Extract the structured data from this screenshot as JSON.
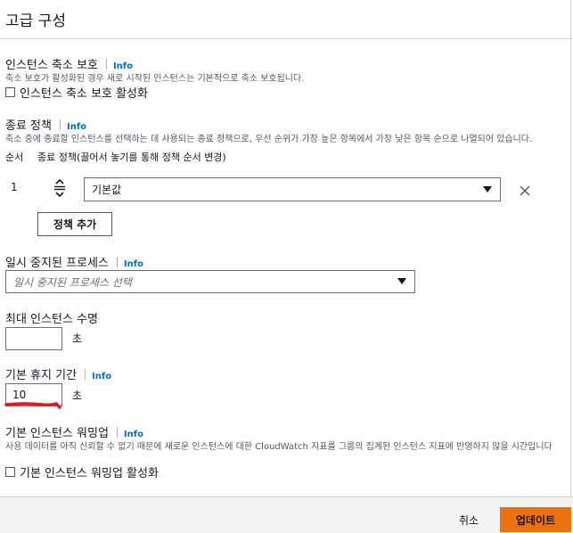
{
  "header": {
    "title": "고급 구성"
  },
  "scale_in_protection": {
    "label": "인스턴스 축소 보호",
    "info": "Info",
    "description": "축소 보호가 활성화된 경우 새로 시작된 인스턴스는 기본적으로 축소 보호됩니다.",
    "checkbox_label": "인스턴스 축소 보호 활성화",
    "checked": false
  },
  "termination_policy": {
    "label": "종료 정책",
    "info": "Info",
    "description": "축소 중에 종료할 인스턴스를 선택하는 데 사용되는 종료 정책으로, 우선 순위가 가장 높은 항목에서 가장 낮은 항목 순으로 나열되어 있습니다.",
    "col_order": "순서",
    "col_policy": "종료 정책(끌어서 놓기를 통해 정책 순서 변경)",
    "rows": [
      {
        "order": "1",
        "value": "기본값"
      }
    ],
    "add_button": "정책 추가"
  },
  "suspended_processes": {
    "label": "일시 중지된 프로세스",
    "info": "Info",
    "placeholder": "일시 중지된 프로세스 선택"
  },
  "max_instance_lifetime": {
    "label": "최대 인스턴스 수명",
    "value": "",
    "unit": "초"
  },
  "default_cooldown": {
    "label": "기본 휴지 기간",
    "info": "Info",
    "value": "10",
    "unit": "초"
  },
  "default_warmup": {
    "label": "기본 인스턴스 워밍업",
    "info": "Info",
    "description": "사용 데이터를 아직 신뢰할 수 없기 때문에 새로운 인스턴스에 대한 CloudWatch 지표를 그룹의 집계된 인스턴스 지표에 반영하지 않을 시간입니다",
    "checkbox_label": "기본 인스턴스 워밍업 활성화",
    "checked": false
  },
  "footer": {
    "cancel_label": "취소",
    "update_label": "업데이트"
  },
  "colors": {
    "accent": "#ec7211",
    "link": "#0073bb",
    "annotation": "#e8161b"
  },
  "icons": {
    "drag_handle": "drag-handle-icon",
    "remove": "close-icon",
    "dropdown": "caret-down-icon"
  }
}
